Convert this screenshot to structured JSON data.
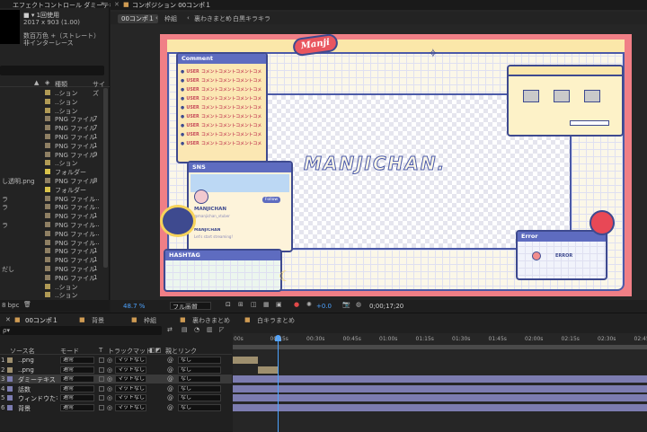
{
  "project_panel": {
    "tabs": [
      "エフェクトコントロール ダミーテキスト",
      "»"
    ],
    "item_name": "■ ▾ 1回使用",
    "item_info1": "2017 x 903 (1.00)",
    "item_info2": "数百万色 +（ストレート）",
    "item_info3": "非インターレース",
    "col_type": "種類",
    "col_size": "サイズ",
    "rows": [
      {
        "name": "",
        "type": "..ション",
        "size": "",
        "color": "#b09a55"
      },
      {
        "name": "",
        "type": "..ション",
        "size": "",
        "color": "#b09a55"
      },
      {
        "name": "",
        "type": "..ション",
        "size": "",
        "color": "#b09a55"
      },
      {
        "name": "",
        "type": "PNG ファイル",
        "size": "7",
        "color": "#8e7f63"
      },
      {
        "name": "",
        "type": "PNG ファイル",
        "size": "7",
        "color": "#8e7f63"
      },
      {
        "name": "",
        "type": "PNG ファイル",
        "size": "1",
        "color": "#8e7f63"
      },
      {
        "name": "",
        "type": "PNG ファイル",
        "size": "1",
        "color": "#8e7f63"
      },
      {
        "name": "",
        "type": "PNG ファイル",
        "size": "9",
        "color": "#8e7f63"
      },
      {
        "name": "",
        "type": "..ション",
        "size": "",
        "color": "#b09a55"
      },
      {
        "name": "",
        "type": "フォルダー",
        "size": "",
        "color": "#d8c24a"
      },
      {
        "name": "し透明.png",
        "type": "PNG ファイル",
        "size": "8",
        "color": "#8e7f63"
      },
      {
        "name": "",
        "type": "フォルダー",
        "size": "",
        "color": "#d8c24a"
      },
      {
        "name": "ラ",
        "type": "PNG ファイル",
        "size": "...",
        "color": "#8e7f63"
      },
      {
        "name": "ラ",
        "type": "PNG ファイル",
        "size": "...",
        "color": "#8e7f63"
      },
      {
        "name": "",
        "type": "PNG ファイル",
        "size": "1",
        "color": "#8e7f63"
      },
      {
        "name": "ラ",
        "type": "PNG ファイル",
        "size": "...",
        "color": "#8e7f63"
      },
      {
        "name": "",
        "type": "PNG ファイル",
        "size": "...",
        "color": "#8e7f63"
      },
      {
        "name": "",
        "type": "PNG ファイル",
        "size": "...",
        "color": "#8e7f63"
      },
      {
        "name": "",
        "type": "PNG ファイル",
        "size": "1",
        "color": "#8e7f63"
      },
      {
        "name": "",
        "type": "PNG ファイル",
        "size": "1",
        "color": "#8e7f63"
      },
      {
        "name": "だし",
        "type": "PNG ファイル",
        "size": "1",
        "color": "#8e7f63"
      },
      {
        "name": "",
        "type": "PNG ファイル",
        "size": "1",
        "color": "#8e7f63"
      },
      {
        "name": "",
        "type": "..ション",
        "size": "",
        "color": "#b09a55"
      },
      {
        "name": "",
        "type": "..ション",
        "size": "",
        "color": "#b09a55"
      }
    ],
    "bpc": "8 bpc"
  },
  "viewer": {
    "panel_tab": "コンポジション 00コンポ１",
    "breadcrumbs": [
      "00コンポ１",
      "枠組",
      "裏わきまとめ",
      "白黒キラキラ"
    ],
    "zoom": "48.7 %",
    "quality": "フル画質",
    "exposure": "+0.0",
    "timecode": "0;00;17;20"
  },
  "overlay": {
    "logo": "Manji",
    "comment_title": "Comment",
    "comment_user": "USER",
    "comment_text": "コメントコメントコメントコメ",
    "sns_title": "SNS",
    "sns_name": "MANJICHAN",
    "sns_handle": "@manjichan_vtuber",
    "sns_follow": "Follow",
    "sns_post_name": "MANJICHAN",
    "sns_post_text": "Let's start streaming!",
    "hashtag_title": "HASHTAG",
    "banner": "MANJICHAN.",
    "error_title": "Error",
    "error_text": "ERROR"
  },
  "timeline": {
    "tabs": [
      "00コンポ１",
      "背景",
      "枠組",
      "裏わきまとめ",
      "白キラまとめ"
    ],
    "search_placeholder": "ρ▾",
    "time_display": "0;00;17;20",
    "col_source": "ソース名",
    "col_mode": "モード",
    "col_t": "T",
    "col_trackmatte": "トラックマット",
    "col_parent": "親とリンク",
    "ruler": [
      "00s",
      "00:15s",
      "00:30s",
      "00:45s",
      "01:00s",
      "01:15s",
      "01:30s",
      "01:45s",
      "02:00s",
      "02:15s",
      "02:30s",
      "02:45s"
    ],
    "layers": [
      {
        "idx": "1",
        "name": "..png",
        "mode": "通常",
        "matte": "マットなし",
        "parent": "なし",
        "color": "#9e8f6e"
      },
      {
        "idx": "2",
        "name": "..png",
        "mode": "通常",
        "matte": "マットなし",
        "parent": "なし",
        "color": "#9e8f6e"
      },
      {
        "idx": "3",
        "name": "ダミーテキスト",
        "mode": "通常",
        "matte": "マットなし",
        "parent": "なし",
        "color": "#7c7cb0"
      },
      {
        "idx": "4",
        "name": "話数",
        "mode": "通常",
        "matte": "マットなし",
        "parent": "なし",
        "color": "#7c7cb0"
      },
      {
        "idx": "5",
        "name": "ウィンドウたち",
        "mode": "通常",
        "matte": "マットなし",
        "parent": "なし",
        "color": "#7c7cb0"
      },
      {
        "idx": "6",
        "name": "背景",
        "mode": "通常",
        "matte": "マットなし",
        "parent": "なし",
        "color": "#7c7cb0"
      }
    ]
  }
}
